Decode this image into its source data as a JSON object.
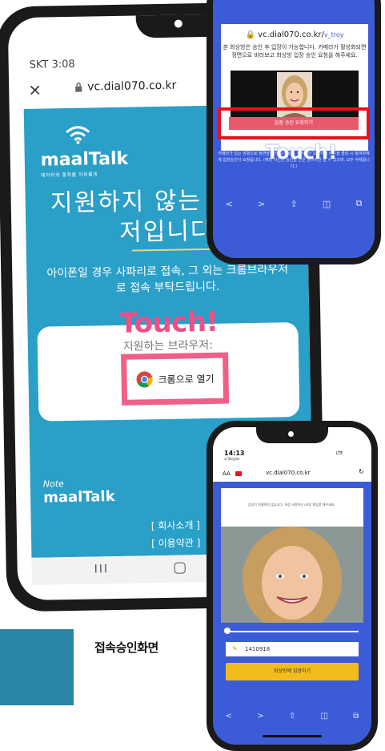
{
  "phone1": {
    "status_time": "SKT 3:08",
    "close_icon": "×",
    "url": "vc.dial070.co.kr",
    "logo_brand": "maalTalk",
    "logo_subtitle": "데이터와 통화를 자유롭게",
    "unsupported_line1": "지원하지 않는 브라우",
    "unsupported_line2": "저입니다",
    "iphone_message": "아이폰일 경우 사파리로 접속, 그 외는 크롬브라우저",
    "iphone_message2": "로 접속 부탁드립니다.",
    "touch_label": "Touch!",
    "supported_label": "지원하는 브라우저:",
    "chrome_button": "크롬으로 열기",
    "note_label": "Note",
    "footer_brand": "maalTalk",
    "footer_link1": "[ 회사소개 ]",
    "footer_link2": "[ 이용약관 ]",
    "nav_recent": "III"
  },
  "phone2": {
    "url": "vc.dial070.co.kr/",
    "url_path": "v_troy",
    "message": "본 화상방은 승인 후 입장이 가능합니다. 카메라가 활성화되면 정면으로 바라보고 화상방 입장 승인 요청을 해주세요.",
    "request_button": "입장 승인 요청하기",
    "note": "카메라가 있는 방향으로 정면을 바라 보주세요. 입장승인 요청하기 버튼을 클릭 시 참여자에게 입장승인이 요청됩니다. (해당 사진은 승인을 받은 참여자만 볼 수 있으며, 모두 삭제됩니다.)",
    "touch_label": "Touch!"
  },
  "phone3": {
    "status_time": "14:13",
    "skype": "◂ Skype",
    "signal": "LTE",
    "aa_label": "AA",
    "url": "vc.dial070.co.kr",
    "message": "음성이 연결하지 않습니다. 처음 사용하신 url로 재입장 해주세요.",
    "input_value": "1410918",
    "enter_button": "화상방에 입장하기"
  },
  "caption": "접속승인화면",
  "colors": {
    "android_blue": "#2a9fc8",
    "touch_pink": "#f04e86",
    "iphone_blue": "#3c5bd6",
    "request_red": "#e8121a",
    "enter_yellow": "#f2bd1c"
  }
}
